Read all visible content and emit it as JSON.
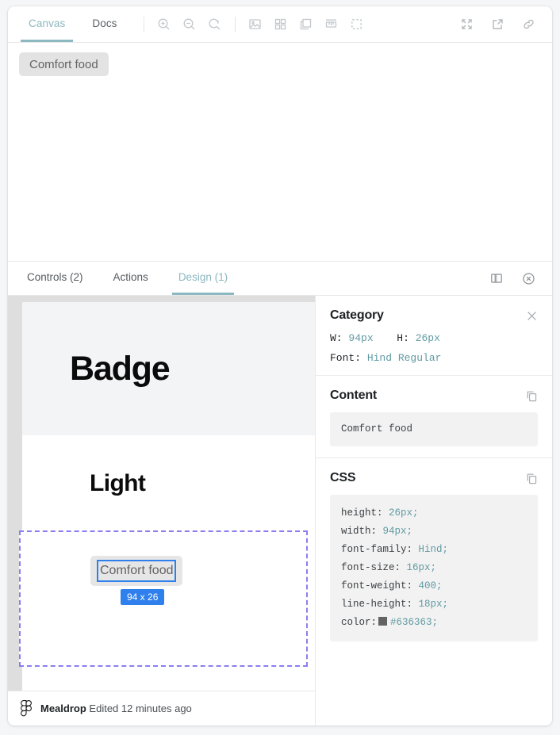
{
  "toolbar": {
    "tabs": [
      {
        "label": "Canvas",
        "active": true
      },
      {
        "label": "Docs",
        "active": false
      }
    ],
    "zoom_icons": [
      "zoom-in-icon",
      "zoom-out-icon",
      "zoom-reset-icon"
    ],
    "view_icons": [
      "image-icon",
      "grid-icon",
      "layers-icon",
      "ruler-icon",
      "select-area-icon"
    ],
    "right_icons": [
      "fullscreen-icon",
      "open-external-icon",
      "link-icon"
    ]
  },
  "canvas": {
    "badge_label": "Comfort food"
  },
  "panel_tabs": {
    "tabs": [
      {
        "label": "Controls (2)",
        "active": false
      },
      {
        "label": "Actions",
        "active": false
      },
      {
        "label": "Design (1)",
        "active": true
      }
    ],
    "right_icons": [
      "split-panel-icon",
      "close-circle-icon"
    ]
  },
  "preview": {
    "headline_badge": "Badge",
    "headline_light": "Light",
    "selected_element_text": "Comfort food",
    "size_tag": "94 x 26",
    "footer": {
      "file_name": "Mealdrop",
      "edited_text": "Edited 12 minutes ago",
      "icon": "figma-icon"
    }
  },
  "inspector": {
    "category": {
      "title": "Category",
      "close_icon": "close-icon",
      "width_label": "W:",
      "width_value": "94px",
      "height_label": "H:",
      "height_value": "26px",
      "font_label": "Font:",
      "font_value": "Hind Regular"
    },
    "content": {
      "title": "Content",
      "copy_icon": "copy-icon",
      "value": "Comfort food"
    },
    "css": {
      "title": "CSS",
      "copy_icon": "copy-icon",
      "declarations": [
        {
          "prop": "height:",
          "value": "26px",
          "swatch": null
        },
        {
          "prop": "width:",
          "value": "94px",
          "swatch": null
        },
        {
          "prop": "font-family:",
          "value": "Hind",
          "swatch": null
        },
        {
          "prop": "font-size:",
          "value": "16px",
          "swatch": null
        },
        {
          "prop": "font-weight:",
          "value": "400",
          "swatch": null
        },
        {
          "prop": "line-height:",
          "value": "18px",
          "swatch": null
        },
        {
          "prop": "color:",
          "value": "#636363",
          "swatch": "#636363"
        }
      ]
    }
  },
  "colors": {
    "accent_teal": "#8cb8bf",
    "value_teal": "#5f9aa2",
    "selection_blue": "#2f80ed",
    "selection_purple": "#8b7ef0",
    "text_color": "#636363"
  }
}
